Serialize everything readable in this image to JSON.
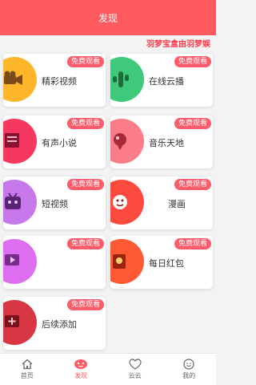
{
  "header": {
    "title": "发现"
  },
  "marquee": {
    "text": "羽梦宝盒由羽梦娱"
  },
  "badge_text": "免费观看",
  "cards": [
    {
      "label": "精彩视频",
      "icon": "video-camera-icon",
      "color": "#ffb62a"
    },
    {
      "label": "在线云播",
      "icon": "cactus-icon",
      "color": "#3fc97b"
    },
    {
      "label": "有声小说",
      "icon": "book-icon",
      "color": "#f6375f"
    },
    {
      "label": "音乐天地",
      "icon": "music-balloon-icon",
      "color": "#fb7d8a"
    },
    {
      "label": "短视频",
      "icon": "robot-tv-icon",
      "color": "#c778ea"
    },
    {
      "label": "漫画",
      "icon": "cartoon-face-icon",
      "color": "#fd4a3f"
    },
    {
      "label": "",
      "icon": "play-icon",
      "color": "#dd6ef0"
    },
    {
      "label": "每日红包",
      "icon": "red-envelope-icon",
      "color": "#fd5a33"
    },
    {
      "label": "后续添加",
      "icon": "plus-box-icon",
      "color": "#d93644"
    }
  ],
  "tabbar": {
    "items": [
      {
        "label": "首页",
        "icon": "home-icon"
      },
      {
        "label": "发现",
        "icon": "discover-icon",
        "active": true
      },
      {
        "label": "云云",
        "icon": "heart-icon"
      },
      {
        "label": "我的",
        "icon": "smile-icon"
      }
    ],
    "active_color": "#fe5a5f"
  }
}
